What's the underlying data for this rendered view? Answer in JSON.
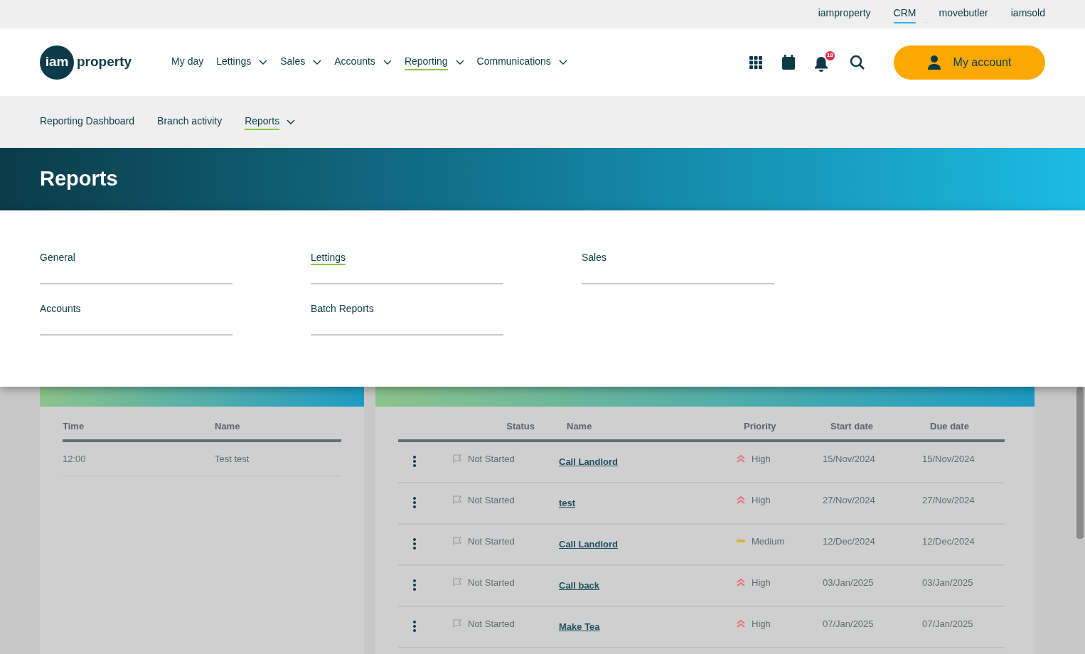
{
  "brand_links": [
    {
      "label": "iamproperty",
      "selected": false
    },
    {
      "label": "CRM",
      "selected": true
    },
    {
      "label": "movebutler",
      "selected": false
    },
    {
      "label": "iamsold",
      "selected": false
    }
  ],
  "logo": {
    "mark": "iam",
    "word": "property"
  },
  "main_nav": [
    {
      "label": "My day",
      "dropdown": false,
      "selected": false
    },
    {
      "label": "Lettings",
      "dropdown": true,
      "selected": false
    },
    {
      "label": "Sales",
      "dropdown": true,
      "selected": false
    },
    {
      "label": "Accounts",
      "dropdown": true,
      "selected": false
    },
    {
      "label": "Reporting",
      "dropdown": true,
      "selected": true
    },
    {
      "label": "Communications",
      "dropdown": true,
      "selected": false
    }
  ],
  "notifications": {
    "count": "18"
  },
  "account_button": {
    "label": "My account"
  },
  "sub_nav": [
    {
      "label": "Reporting Dashboard",
      "dropdown": false,
      "selected": false
    },
    {
      "label": "Branch activity",
      "dropdown": false,
      "selected": false
    },
    {
      "label": "Reports",
      "dropdown": true,
      "selected": true
    }
  ],
  "banner": {
    "title": "Reports"
  },
  "reports_menu": [
    {
      "label": "General",
      "selected": false
    },
    {
      "label": "Lettings",
      "selected": true
    },
    {
      "label": "Sales",
      "selected": false
    },
    {
      "label": "Accounts",
      "selected": false
    },
    {
      "label": "Batch Reports",
      "selected": false
    }
  ],
  "events": {
    "columns": [
      "Time",
      "Name"
    ],
    "rows": [
      [
        "12:00",
        "Test test"
      ]
    ]
  },
  "tasks": {
    "columns": [
      "Status",
      "Name",
      "Priority",
      "Start date",
      "Due date"
    ],
    "rows": [
      {
        "status": "Not Started",
        "name": "Call Landlord",
        "priority": "High",
        "kind": "high",
        "start": "15/Nov/2024",
        "due": "15/Nov/2024"
      },
      {
        "status": "Not Started",
        "name": "test",
        "priority": "High",
        "kind": "high",
        "start": "27/Nov/2024",
        "due": "27/Nov/2024"
      },
      {
        "status": "Not Started",
        "name": "Call Landlord",
        "priority": "Medium",
        "kind": "medium",
        "start": "12/Dec/2024",
        "due": "12/Dec/2024"
      },
      {
        "status": "Not Started",
        "name": "Call back",
        "priority": "High",
        "kind": "high",
        "start": "03/Jan/2025",
        "due": "03/Jan/2025"
      },
      {
        "status": "Not Started",
        "name": "Make Tea",
        "priority": "High",
        "kind": "high",
        "start": "07/Jan/2025",
        "due": "07/Jan/2025"
      }
    ]
  }
}
